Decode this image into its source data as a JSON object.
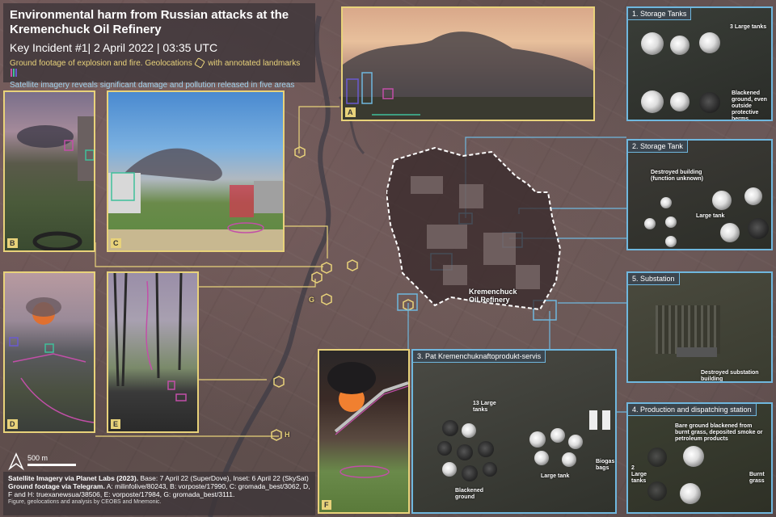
{
  "header": {
    "title": "Environmental harm from Russian attacks at the Kremenchuck Oil Refinery",
    "subtitle": "Key Incident #1| 2 April 2022 | 03:35 UTC",
    "note_ground_pre": "Ground footage of explosion and fire. Geolocations",
    "note_ground_post": "with annotated landmarks",
    "note_satellite": "Satellite imagery reveals significant damage and pollution released in five areas"
  },
  "photos": [
    {
      "label": "A"
    },
    {
      "label": "B"
    },
    {
      "label": "C"
    },
    {
      "label": "D"
    },
    {
      "label": "E"
    },
    {
      "label": "F"
    }
  ],
  "map_labels": {
    "refinery": "Kremenchuck Oil Refinery",
    "g": "G",
    "h": "H",
    "scale": "500 m"
  },
  "panels": {
    "p1": {
      "title": "1. Storage Tanks",
      "ann1": "3 Large tanks",
      "ann2": "Blackened ground, even outside protective berms"
    },
    "p2": {
      "title": "2. Storage Tank",
      "ann1": "Destroyed building (function unknown)",
      "ann2": "Large tank"
    },
    "p5": {
      "title": "5. Substation",
      "ann1": "Destroyed substation building"
    },
    "p3": {
      "title": "3. Pat Kremenchuknaftoprodukt-servis",
      "ann1": "13 Large tanks",
      "ann2": "Large tank",
      "ann3": "Blackened ground",
      "ann4": "Biogas bags"
    },
    "p4": {
      "title": "4. Production and dispatching station",
      "ann1": "Bare ground blackened from burnt grass, deposited smoke or petroleum products",
      "ann2": "2 Large tanks",
      "ann3": "Burnt grass"
    }
  },
  "footer": {
    "sat_bold": "Satellite Imagery via Planet Labs (2023).",
    "sat_rest": "Base: 7 April 22 (SuperDove), Inset: 6 April 22 (SkySat)",
    "ground_bold": "Ground footage via Telegram.",
    "ground_rest": "A: milinfolive/80243, B: vorposte/17990, C: gromada_best/3062, D, F and H: truexanewsua/38506, E: vorposte/17984, G: gromada_best/3111.",
    "credit": "Figure, geolocations and analysis by CEOBS and Mnemonic."
  },
  "colors": {
    "ground": "#e8d27a",
    "satellite": "#6fb7de",
    "magenta": "#c24fa8",
    "green": "#3fbf9a"
  },
  "icons": [
    "hexagon-icon",
    "north-arrow-icon"
  ]
}
